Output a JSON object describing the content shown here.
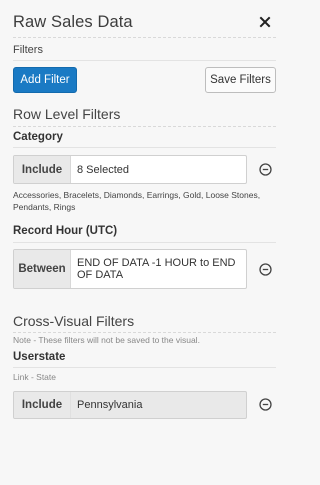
{
  "panel": {
    "title": "Raw Sales Data",
    "close_icon": "close-icon",
    "filters_label": "Filters",
    "add_filter_label": "Add Filter",
    "save_filters_label": "Save Filters"
  },
  "row_level": {
    "title": "Row Level Filters",
    "filters": [
      {
        "label": "Category",
        "operator": "Include",
        "value": "8 Selected",
        "details": "Accessories, Bracelets, Diamonds, Earrings, Gold, Loose Stones, Pendants, Rings"
      },
      {
        "label": "Record Hour (UTC)",
        "operator": "Between",
        "value": "END OF DATA -1 HOUR to END OF DATA"
      }
    ]
  },
  "cross_visual": {
    "title": "Cross-Visual Filters",
    "note": "Note - These filters will not be saved to the visual.",
    "filters": [
      {
        "label": "Userstate",
        "link": "Link - State",
        "operator": "Include",
        "value": "Pennsylvania"
      }
    ]
  },
  "colors": {
    "primary_button": "#1a7ac4",
    "background": "#f7f7f7",
    "operator_bg": "#e9e9e9"
  }
}
